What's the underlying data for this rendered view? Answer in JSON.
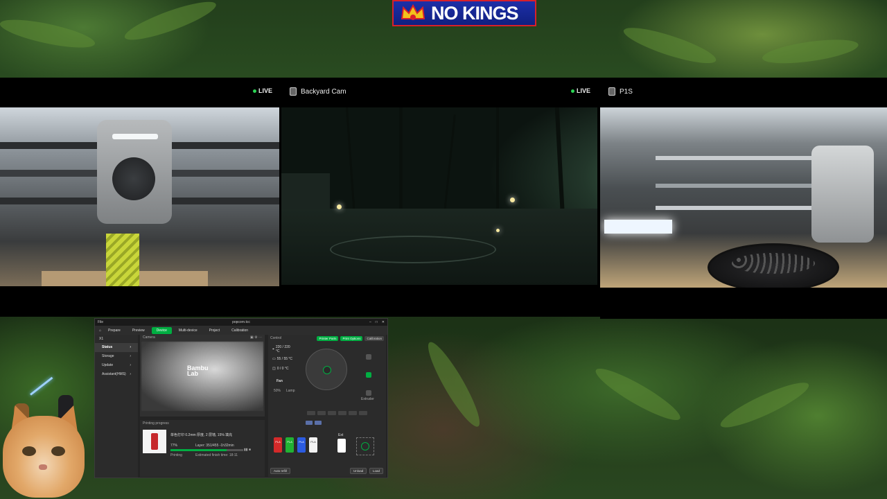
{
  "banner": {
    "text": "NO KINGS",
    "colors": {
      "bg": "#1d2fa8",
      "border": "#d8202a"
    }
  },
  "cameras": [
    {
      "title": "",
      "live_label": "LIVE",
      "icon": "camera-icon"
    },
    {
      "title": "Backyard Cam",
      "live_label": "LIVE",
      "icon": "camera-icon"
    },
    {
      "title": "P1S",
      "live_label": "",
      "icon": "camera-icon"
    }
  ],
  "bambu": {
    "window_title": "popcorn.tcc",
    "menu_label": "File",
    "tabs": [
      "Prepare",
      "Preview",
      "Device",
      "Multi-device",
      "Project",
      "Calibration"
    ],
    "active_tab": "Device",
    "device_name": "X1",
    "sidebar": [
      "Status",
      "Storage",
      "Update",
      "Assistant(HMS)"
    ],
    "camera_header": "Camera",
    "logo_top": "Bambu",
    "logo_bottom": "Lab",
    "printing_progress_label": "Printing progress",
    "job_title": "单色打印 0.2mm 厚度, 2 层墙, 15% 填充",
    "progress_percent": "77%",
    "progress_fraction": 0.77,
    "layer": "Layer: 351/455",
    "time_left": "-1h32min",
    "status": "Printing",
    "remaining": "Estimated finish time: 18:11",
    "control_label": "Control",
    "buttons": {
      "printer_parts": "Printer Parts",
      "print_options": "Print Options",
      "calibration": "Calibration"
    },
    "temps": [
      "220 / 220 °C",
      "55 / 55 °C",
      "0 / 0 °C"
    ],
    "fan_label": "Fan",
    "fan_value": "50%",
    "lamp_label": "Lamp",
    "extruder_label": "Extruder",
    "ext_label": "Ext",
    "spools": [
      {
        "label": "PLA",
        "color": "#d42a2a"
      },
      {
        "label": "PLA",
        "color": "#21b233"
      },
      {
        "label": "PLA",
        "color": "#2b5be0"
      },
      {
        "label": "PLA",
        "color": "#f2f2f2"
      }
    ],
    "ams_button": "Auto refill",
    "unload_button": "Unload",
    "load_button": "Load"
  }
}
